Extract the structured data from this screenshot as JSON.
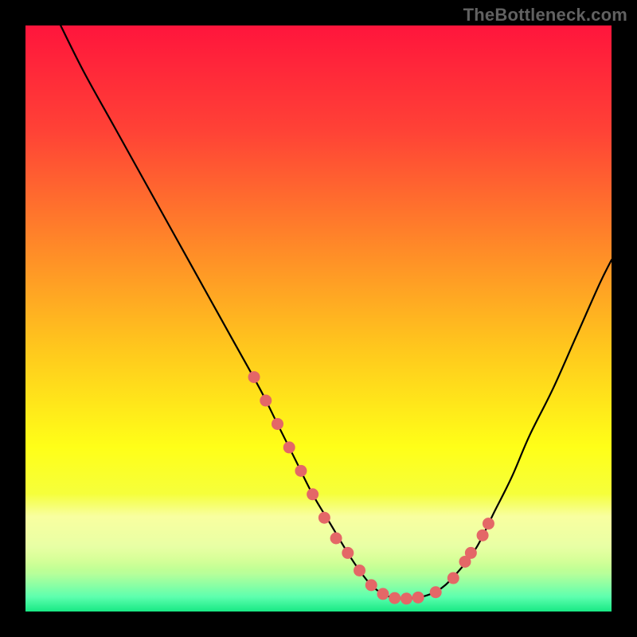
{
  "watermark": "TheBottleneck.com",
  "colors": {
    "frame_bg": "#000000",
    "curve_stroke": "#000000",
    "dot_fill": "#e46767",
    "gradient_stops": [
      {
        "offset": 0.0,
        "color": "#ff153c"
      },
      {
        "offset": 0.18,
        "color": "#ff4236"
      },
      {
        "offset": 0.38,
        "color": "#ff8a28"
      },
      {
        "offset": 0.55,
        "color": "#ffc71d"
      },
      {
        "offset": 0.72,
        "color": "#ffff18"
      },
      {
        "offset": 0.82,
        "color": "#f3ff44"
      },
      {
        "offset": 0.885,
        "color": "#e9ff75"
      },
      {
        "offset": 0.935,
        "color": "#b8ff9a"
      },
      {
        "offset": 0.975,
        "color": "#5dffae"
      },
      {
        "offset": 1.0,
        "color": "#18e884"
      }
    ],
    "haze_band": {
      "top_color": "#ffffe0",
      "bottom_color": "#e0ffc0"
    }
  },
  "chart_data": {
    "type": "line",
    "title": "",
    "xlabel": "",
    "ylabel": "",
    "xlim": [
      0,
      100
    ],
    "ylim": [
      0,
      100
    ],
    "grid": false,
    "legend": false,
    "annotations": [],
    "series": [
      {
        "name": "bottleneck-curve",
        "x": [
          6,
          10,
          15,
          20,
          25,
          30,
          35,
          40,
          43,
          46,
          49,
          52,
          55,
          57,
          59,
          61,
          63,
          65,
          68,
          71,
          74,
          77,
          80,
          83,
          86,
          90,
          94,
          98,
          100
        ],
        "y": [
          100,
          92,
          83,
          74,
          65,
          56,
          47,
          38,
          32,
          26,
          20,
          15,
          10,
          7,
          4.5,
          3,
          2.3,
          2.2,
          2.6,
          4,
          7,
          11,
          17,
          23,
          30,
          38,
          47,
          56,
          60
        ]
      }
    ],
    "dots": {
      "name": "highlighted-points",
      "x": [
        39,
        41,
        43,
        45,
        47,
        49,
        51,
        53,
        55,
        57,
        59,
        61,
        63,
        65,
        67,
        70,
        73,
        75,
        76,
        78,
        79
      ],
      "y": [
        40,
        36,
        32,
        28,
        24,
        20,
        16,
        12.5,
        10,
        7,
        4.5,
        3,
        2.3,
        2.2,
        2.4,
        3.3,
        5.7,
        8.5,
        10,
        13,
        15
      ]
    }
  }
}
